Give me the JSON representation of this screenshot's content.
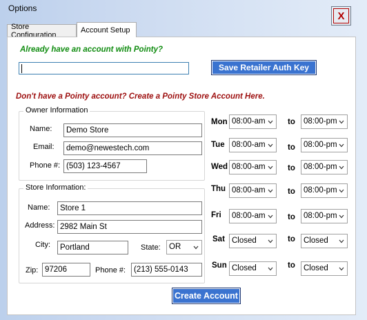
{
  "window": {
    "title": "Options",
    "close_label": "X"
  },
  "tabs": [
    {
      "label": "Store Configuration",
      "active": false
    },
    {
      "label": "Account Setup",
      "active": true
    }
  ],
  "existing": {
    "heading": "Already have an account with Pointy?",
    "auth_key_value": "",
    "save_button": "Save Retailer Auth Key"
  },
  "new_account": {
    "heading": "Don't have a Pointy account? Create a Pointy Store Account Here."
  },
  "owner": {
    "legend": "Owner Information",
    "name_label": "Name:",
    "name_value": "Demo Store",
    "email_label": "Email:",
    "email_value": "demo@newestech.com",
    "phone_label": "Phone #:",
    "phone_value": "(503) 123-4567"
  },
  "store": {
    "legend": "Store Information:",
    "name_label": "Name:",
    "name_value": "Store 1",
    "address_label": "Address:",
    "address_value": "2982 Main St",
    "city_label": "City:",
    "city_value": "Portland",
    "state_label": "State:",
    "state_value": "OR",
    "zip_label": "Zip:",
    "zip_value": "97206",
    "phone_label": "Phone #:",
    "phone_value": "(213) 555-0143"
  },
  "hours": {
    "to_label": "to",
    "days": [
      {
        "day": "Mon",
        "open": "08:00-am",
        "close": "08:00-pm"
      },
      {
        "day": "Tue",
        "open": "08:00-am",
        "close": "08:00-pm"
      },
      {
        "day": "Wed",
        "open": "08:00-am",
        "close": "08:00-pm"
      },
      {
        "day": "Thu",
        "open": "08:00-am",
        "close": "08:00-pm"
      },
      {
        "day": "Fri",
        "open": "08:00-am",
        "close": "08:00-pm"
      },
      {
        "day": "Sat",
        "open": "Closed",
        "close": "Closed"
      },
      {
        "day": "Sun",
        "open": "Closed",
        "close": "Closed"
      }
    ]
  },
  "create_button": "Create Account",
  "colors": {
    "title_bar_gradient_start": "#bcd0ec",
    "heading_green": "#108c10",
    "heading_red": "#9d0f0f",
    "button_blue": "#3a73d0",
    "close_red": "#b20000"
  },
  "icons": {
    "dropdown": "chevron-down-icon"
  }
}
